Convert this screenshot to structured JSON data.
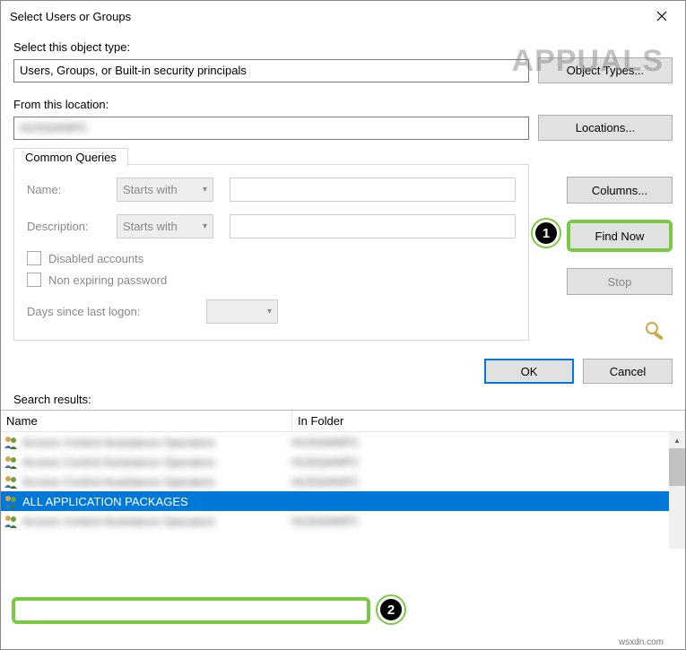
{
  "title": "Select Users or Groups",
  "labels": {
    "object_type": "Select this object type:",
    "from_location": "From this location:",
    "common_queries": "Common Queries",
    "name": "Name:",
    "description": "Description:",
    "starts_with": "Starts with",
    "disabled_accounts": "Disabled accounts",
    "non_expiring": "Non expiring password",
    "days_logon": "Days since last logon:",
    "search_results": "Search results:",
    "col_name": "Name",
    "col_folder": "In Folder"
  },
  "fields": {
    "object_type_value": "Users, Groups, or Built-in security principals",
    "location_value": ""
  },
  "buttons": {
    "object_types": "Object Types...",
    "locations": "Locations...",
    "columns": "Columns...",
    "find_now": "Find Now",
    "stop": "Stop",
    "ok": "OK",
    "cancel": "Cancel"
  },
  "results": [
    {
      "name_blurred": true,
      "folder_blurred": true
    },
    {
      "name_blurred": true,
      "folder_blurred": true
    },
    {
      "name_blurred": true,
      "folder_blurred": true
    },
    {
      "name": "ALL APPLICATION PACKAGES",
      "selected": true
    },
    {
      "name_blurred": true,
      "folder_blurred": true
    }
  ],
  "callouts": {
    "1": "1",
    "2": "2"
  },
  "watermark": "APPUALS",
  "source": "wsxdn.com"
}
